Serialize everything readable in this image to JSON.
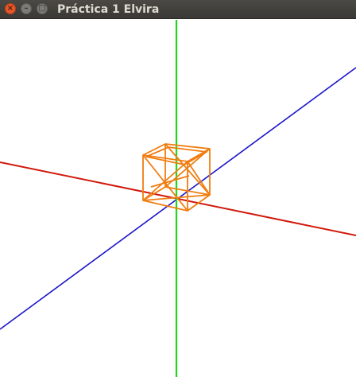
{
  "window": {
    "title": "Práctica 1 Elvira",
    "buttons": {
      "close_glyph": "×",
      "minimize_glyph": "–",
      "maximize_glyph": "□"
    }
  },
  "scene": {
    "colors": {
      "x_axis": "#d11a0e",
      "y_axis": "#22d61e",
      "z_axis": "#1c16c8",
      "cube": "#f07d10",
      "background": "#ffffff"
    }
  }
}
